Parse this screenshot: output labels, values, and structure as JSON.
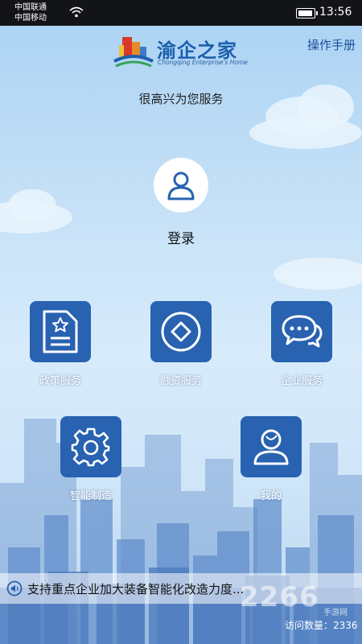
{
  "status_bar": {
    "carrier1": "中国联通",
    "carrier2": "中国移动",
    "time": "13:56"
  },
  "header": {
    "app_title": "渝企之家",
    "app_subtitle": "Chongqing Enterprise's Home",
    "manual_link": "操作手册"
  },
  "welcome_text": "很高兴为您服务",
  "login": {
    "label": "登录",
    "icon": "user-icon"
  },
  "tiles": [
    {
      "label": "政策服务",
      "icon": "policy-document-icon"
    },
    {
      "label": "融资服务",
      "icon": "coin-icon"
    },
    {
      "label": "企业服务",
      "icon": "chat-icon"
    },
    {
      "label": "智能制造",
      "icon": "gear-icon"
    },
    {
      "label": "我的",
      "icon": "profile-icon"
    }
  ],
  "news": {
    "text": "支持重点企业加大装备智能化改造力度...",
    "icon": "speaker-icon"
  },
  "visits": "访问数量：2336",
  "watermark": {
    "number": "2266",
    "text": "手游网"
  },
  "colors": {
    "tile_blue": "#2862b1",
    "brand_blue": "#1c5fae"
  }
}
